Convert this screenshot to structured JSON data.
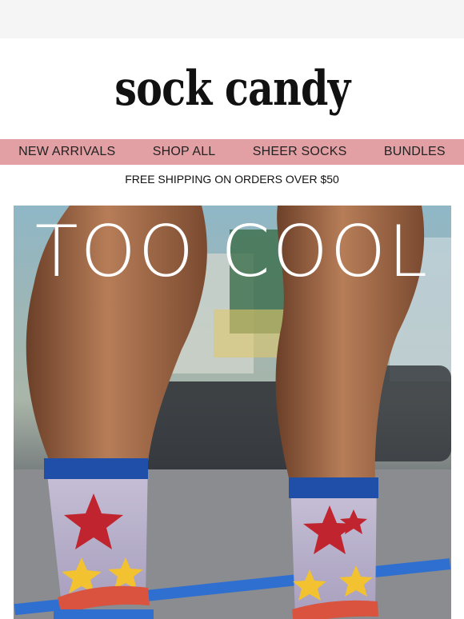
{
  "brand": {
    "logo_text": "sock candy"
  },
  "nav": {
    "items": [
      "NEW ARRIVALS",
      "SHOP ALL",
      "SHEER SOCKS",
      "BUNDLES"
    ]
  },
  "banner": {
    "shipping_text": "FREE SHIPPING ON ORDERS OVER $50"
  },
  "hero": {
    "title": "TOO COOL",
    "image_alt": "legs wearing sheer star-print socks"
  },
  "colors": {
    "nav_bg": "#e3a0a4",
    "sock_band": "#1f4fa8",
    "star_red": "#c0242e",
    "star_yellow": "#f2c230"
  }
}
